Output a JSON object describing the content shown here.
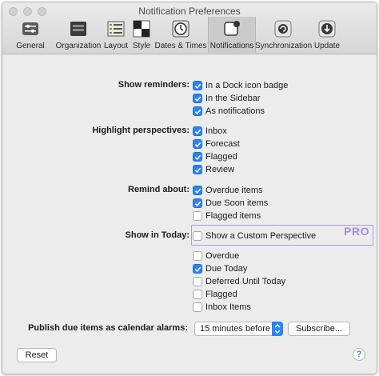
{
  "window": {
    "title": "Notification Preferences"
  },
  "toolbar": {
    "tabs": [
      {
        "label": "General",
        "icon": "sliders-icon"
      },
      {
        "label": "Organization",
        "icon": "tray-icon"
      },
      {
        "label": "Layout",
        "icon": "layout-icon"
      },
      {
        "label": "Style",
        "icon": "palette-icon"
      },
      {
        "label": "Dates & Times",
        "icon": "clock-icon"
      },
      {
        "label": "Notifications",
        "icon": "notification-icon",
        "selected": true
      },
      {
        "label": "Synchronization",
        "icon": "sync-icon"
      },
      {
        "label": "Update",
        "icon": "download-icon"
      }
    ]
  },
  "sections": {
    "show_reminders": {
      "label": "Show reminders:",
      "options": [
        {
          "label": "In a Dock icon badge",
          "checked": true
        },
        {
          "label": "In the Sidebar",
          "checked": true
        },
        {
          "label": "As notifications",
          "checked": true
        }
      ]
    },
    "highlight_perspectives": {
      "label": "Highlight perspectives:",
      "options": [
        {
          "label": "Inbox",
          "checked": true
        },
        {
          "label": "Forecast",
          "checked": true
        },
        {
          "label": "Flagged",
          "checked": true
        },
        {
          "label": "Review",
          "checked": true
        }
      ]
    },
    "remind_about": {
      "label": "Remind about:",
      "options": [
        {
          "label": "Overdue items",
          "checked": true
        },
        {
          "label": "Due Soon items",
          "checked": true
        },
        {
          "label": "Flagged items",
          "checked": false
        }
      ]
    },
    "show_in_today": {
      "label": "Show in Today:",
      "pro_tag": "PRO",
      "options": [
        {
          "label": "Show a Custom Perspective",
          "checked": false
        },
        {
          "label": "Overdue",
          "checked": false
        },
        {
          "label": "Due Today",
          "checked": true
        },
        {
          "label": "Deferred Until Today",
          "checked": false
        },
        {
          "label": "Flagged",
          "checked": false
        },
        {
          "label": "Inbox Items",
          "checked": false
        }
      ]
    }
  },
  "publish": {
    "label": "Publish due items as calendar alarms:",
    "selected": "15 minutes before",
    "subscribe_label": "Subscribe..."
  },
  "footer": {
    "reset_label": "Reset",
    "help_label": "?"
  },
  "colors": {
    "accent": "#2d83f0",
    "pro": "#a78be0"
  }
}
